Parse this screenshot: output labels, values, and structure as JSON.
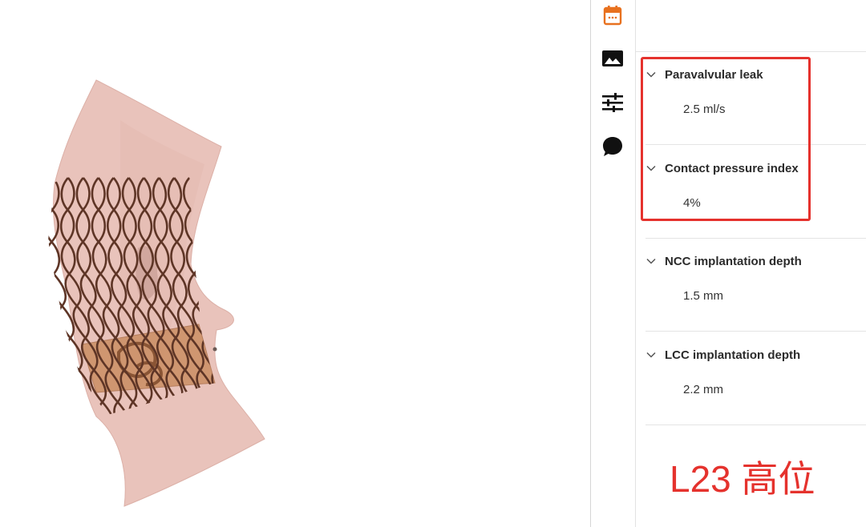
{
  "sidebar": {
    "tools": [
      {
        "name": "calendar",
        "icon": "calendar-icon",
        "active": true
      },
      {
        "name": "image",
        "icon": "image-icon",
        "active": false
      },
      {
        "name": "settings",
        "icon": "sliders-icon",
        "active": false
      },
      {
        "name": "comments",
        "icon": "chat-bubble-icon",
        "active": false
      }
    ]
  },
  "metrics": [
    {
      "label": "Paravalvular leak",
      "value": "2.5 ml/s"
    },
    {
      "label": "Contact pressure index",
      "value": "4%"
    },
    {
      "label": "NCC implantation depth",
      "value": "1.5 mm"
    },
    {
      "label": "LCC implantation depth",
      "value": "2.2 mm"
    }
  ],
  "annotation": "L23 高位",
  "colors": {
    "accent": "#e8711f",
    "highlight": "#e5322d",
    "stent": "#5e3526",
    "tissue": "#e9c3bb",
    "skirt": "#c88a5c"
  }
}
